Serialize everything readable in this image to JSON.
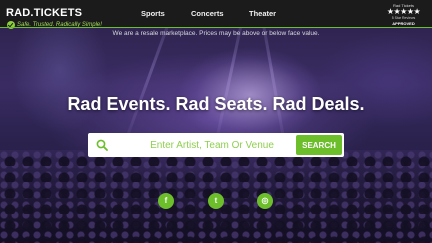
{
  "header": {
    "logo_text": "RAD.TICKETS",
    "tagline": "Safe. Trusted. Radically Simple!",
    "nav": [
      {
        "label": "Sports"
      },
      {
        "label": "Concerts"
      },
      {
        "label": "Theater"
      }
    ],
    "rating_badge": {
      "name": "Rad Tickets",
      "stars": "★★★★★",
      "left_caption": "5 Star Reviews",
      "right_caption": "APPROVED"
    }
  },
  "notice": "We are a resale marketplace. Prices may be above or below face value.",
  "hero": {
    "title": "Rad Events. Rad Seats. Rad Deals."
  },
  "search": {
    "placeholder": "Enter Artist, Team Or Venue",
    "button_label": "SEARCH"
  },
  "social": [
    {
      "icon": "facebook-icon",
      "glyph": "f"
    },
    {
      "icon": "twitter-icon",
      "glyph": "t"
    },
    {
      "icon": "instagram-icon",
      "glyph": "◎"
    }
  ],
  "colors": {
    "accent": "#6cbf2a",
    "header_bg": "#1b1b1b"
  }
}
